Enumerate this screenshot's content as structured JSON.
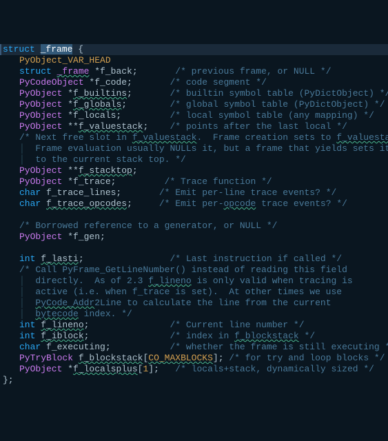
{
  "lines": [
    {
      "cls": "line cur-line",
      "segs": [
        {
          "t": "struct",
          "c": "kw"
        },
        {
          "t": " ",
          "c": ""
        },
        {
          "t": "_frame",
          "c": "sel"
        },
        {
          "t": " {",
          "c": "punct"
        }
      ]
    },
    {
      "cls": "line indent1",
      "segs": [
        {
          "t": "PyObject_VAR_HEAD",
          "c": "macro"
        }
      ]
    },
    {
      "cls": "line indent1",
      "segs": [
        {
          "t": "struct",
          "c": "kw"
        },
        {
          "t": " ",
          "c": ""
        },
        {
          "t": "_frame",
          "c": "cls squig"
        },
        {
          "t": " *f_back;       ",
          "c": "id"
        },
        {
          "t": "/* previous frame, or NULL */",
          "c": "cm"
        }
      ]
    },
    {
      "cls": "line indent1",
      "segs": [
        {
          "t": "PyCodeObject",
          "c": "cls"
        },
        {
          "t": " *f_code;       ",
          "c": "id"
        },
        {
          "t": "/* code segment */",
          "c": "cm"
        }
      ]
    },
    {
      "cls": "line indent1",
      "segs": [
        {
          "t": "PyObject",
          "c": "cls"
        },
        {
          "t": " *",
          "c": "id"
        },
        {
          "t": "f_builtins",
          "c": "id squig"
        },
        {
          "t": ";       ",
          "c": "id"
        },
        {
          "t": "/* builtin symbol table (PyDictObject) */",
          "c": "cm"
        }
      ]
    },
    {
      "cls": "line indent1",
      "segs": [
        {
          "t": "PyObject",
          "c": "cls"
        },
        {
          "t": " *",
          "c": "id"
        },
        {
          "t": "f_globals",
          "c": "id squig"
        },
        {
          "t": ";        ",
          "c": "id"
        },
        {
          "t": "/* global symbol table (PyDictObject) */",
          "c": "cm"
        }
      ]
    },
    {
      "cls": "line indent1",
      "segs": [
        {
          "t": "PyObject",
          "c": "cls"
        },
        {
          "t": " *f_locals;         ",
          "c": "id"
        },
        {
          "t": "/* local symbol table (any mapping) */",
          "c": "cm"
        }
      ]
    },
    {
      "cls": "line indent1",
      "segs": [
        {
          "t": "PyObject",
          "c": "cls"
        },
        {
          "t": " **",
          "c": "id"
        },
        {
          "t": "f_valuestack",
          "c": "id squig"
        },
        {
          "t": ";    ",
          "c": "id"
        },
        {
          "t": "/* points after the last local */",
          "c": "cm"
        }
      ]
    },
    {
      "cls": "line indent1",
      "segs": [
        {
          "t": "/* Next free slot in ",
          "c": "cm"
        },
        {
          "t": "f_valuestack",
          "c": "cm squig"
        },
        {
          "t": ".  Frame creation sets to ",
          "c": "cm"
        },
        {
          "t": "f_valuestack",
          "c": "cm squig"
        },
        {
          "t": ".",
          "c": "cm"
        }
      ]
    },
    {
      "cls": "line indent1",
      "segs": [
        {
          "t": "│",
          "c": "gutter"
        },
        {
          "t": "  Frame evaluation usually NULLs it, but a frame that yields sets it",
          "c": "cm"
        }
      ]
    },
    {
      "cls": "line indent1",
      "segs": [
        {
          "t": "│",
          "c": "gutter"
        },
        {
          "t": "  to the current stack top. */",
          "c": "cm"
        }
      ]
    },
    {
      "cls": "line indent1",
      "segs": [
        {
          "t": "PyObject",
          "c": "cls"
        },
        {
          "t": " **",
          "c": "id"
        },
        {
          "t": "f_stacktop",
          "c": "id squig"
        },
        {
          "t": ";",
          "c": "id"
        }
      ]
    },
    {
      "cls": "line indent1",
      "segs": [
        {
          "t": "PyObject",
          "c": "cls"
        },
        {
          "t": " *f_trace;         ",
          "c": "id"
        },
        {
          "t": "/* Trace function */",
          "c": "cm"
        }
      ]
    },
    {
      "cls": "line indent1",
      "segs": [
        {
          "t": "char",
          "c": "kw"
        },
        {
          "t": " f_trace_lines;       ",
          "c": "id"
        },
        {
          "t": "/* Emit per-line trace events? */",
          "c": "cm"
        }
      ]
    },
    {
      "cls": "line indent1",
      "segs": [
        {
          "t": "char",
          "c": "kw"
        },
        {
          "t": " ",
          "c": "id"
        },
        {
          "t": "f_trace_opcodes",
          "c": "id squig"
        },
        {
          "t": ";     ",
          "c": "id"
        },
        {
          "t": "/* Emit per-",
          "c": "cm"
        },
        {
          "t": "opcode",
          "c": "cm squig"
        },
        {
          "t": " trace events? */",
          "c": "cm"
        }
      ]
    },
    {
      "cls": "line",
      "segs": [
        {
          "t": "",
          "c": ""
        }
      ]
    },
    {
      "cls": "line indent1",
      "segs": [
        {
          "t": "/* Borrowed reference to a generator, or NULL */",
          "c": "cm"
        }
      ]
    },
    {
      "cls": "line indent1",
      "segs": [
        {
          "t": "PyObject",
          "c": "cls"
        },
        {
          "t": " *f_gen;",
          "c": "id"
        }
      ]
    },
    {
      "cls": "line",
      "segs": [
        {
          "t": "",
          "c": ""
        }
      ]
    },
    {
      "cls": "line indent1",
      "segs": [
        {
          "t": "int",
          "c": "kw"
        },
        {
          "t": " ",
          "c": "id"
        },
        {
          "t": "f_lasti",
          "c": "id squig"
        },
        {
          "t": ";                ",
          "c": "id"
        },
        {
          "t": "/* Last instruction if called */",
          "c": "cm"
        }
      ]
    },
    {
      "cls": "line indent1",
      "segs": [
        {
          "t": "/* Call PyFrame_GetLineNumber() instead of reading this field",
          "c": "cm"
        }
      ]
    },
    {
      "cls": "line indent1",
      "segs": [
        {
          "t": "│",
          "c": "gutter"
        },
        {
          "t": "  directly.  As of 2.3 ",
          "c": "cm"
        },
        {
          "t": "f_lineno",
          "c": "cm squig"
        },
        {
          "t": " is only valid when tracing is",
          "c": "cm"
        }
      ]
    },
    {
      "cls": "line indent1",
      "segs": [
        {
          "t": "│",
          "c": "gutter"
        },
        {
          "t": "  active (i.e. when f_trace is set).  At other times we use",
          "c": "cm"
        }
      ]
    },
    {
      "cls": "line indent1",
      "segs": [
        {
          "t": "│",
          "c": "gutter"
        },
        {
          "t": "  ",
          "c": "cm"
        },
        {
          "t": "PyCode_Addr",
          "c": "cm squig"
        },
        {
          "t": "2Line to calculate the line from the current",
          "c": "cm"
        }
      ]
    },
    {
      "cls": "line indent1",
      "segs": [
        {
          "t": "│",
          "c": "gutter"
        },
        {
          "t": "  ",
          "c": "cm"
        },
        {
          "t": "bytecode",
          "c": "cm squig"
        },
        {
          "t": " index. */",
          "c": "cm"
        }
      ]
    },
    {
      "cls": "line indent1",
      "segs": [
        {
          "t": "int",
          "c": "kw"
        },
        {
          "t": " ",
          "c": "id"
        },
        {
          "t": "f_lineno",
          "c": "id squig"
        },
        {
          "t": ";               ",
          "c": "id"
        },
        {
          "t": "/* Current line number */",
          "c": "cm"
        }
      ]
    },
    {
      "cls": "line indent1",
      "segs": [
        {
          "t": "int",
          "c": "kw"
        },
        {
          "t": " ",
          "c": "id"
        },
        {
          "t": "f_iblock",
          "c": "id squig"
        },
        {
          "t": ";               ",
          "c": "id"
        },
        {
          "t": "/* index in ",
          "c": "cm"
        },
        {
          "t": "f_blockstack",
          "c": "cm squig"
        },
        {
          "t": " */",
          "c": "cm"
        }
      ]
    },
    {
      "cls": "line indent1",
      "segs": [
        {
          "t": "char",
          "c": "kw"
        },
        {
          "t": " f_executing;           ",
          "c": "id"
        },
        {
          "t": "/* whether the frame is still executing */",
          "c": "cm"
        }
      ]
    },
    {
      "cls": "line indent1",
      "segs": [
        {
          "t": "PyTryBlock",
          "c": "cls"
        },
        {
          "t": " ",
          "c": "id"
        },
        {
          "t": "f_blockstack",
          "c": "id squig"
        },
        {
          "t": "[",
          "c": "id"
        },
        {
          "t": "CO_MAXBLOCKS",
          "c": "macro squig"
        },
        {
          "t": "]; ",
          "c": "id"
        },
        {
          "t": "/* for try and loop blocks */",
          "c": "cm"
        }
      ]
    },
    {
      "cls": "line indent1",
      "segs": [
        {
          "t": "PyObject",
          "c": "cls"
        },
        {
          "t": " *",
          "c": "id"
        },
        {
          "t": "f_localsplus",
          "c": "id squig"
        },
        {
          "t": "[",
          "c": "id"
        },
        {
          "t": "1",
          "c": "macro"
        },
        {
          "t": "];   ",
          "c": "id"
        },
        {
          "t": "/* locals+stack, dynamically sized */",
          "c": "cm"
        }
      ]
    },
    {
      "cls": "line",
      "segs": [
        {
          "t": "};",
          "c": "punct"
        }
      ]
    }
  ]
}
